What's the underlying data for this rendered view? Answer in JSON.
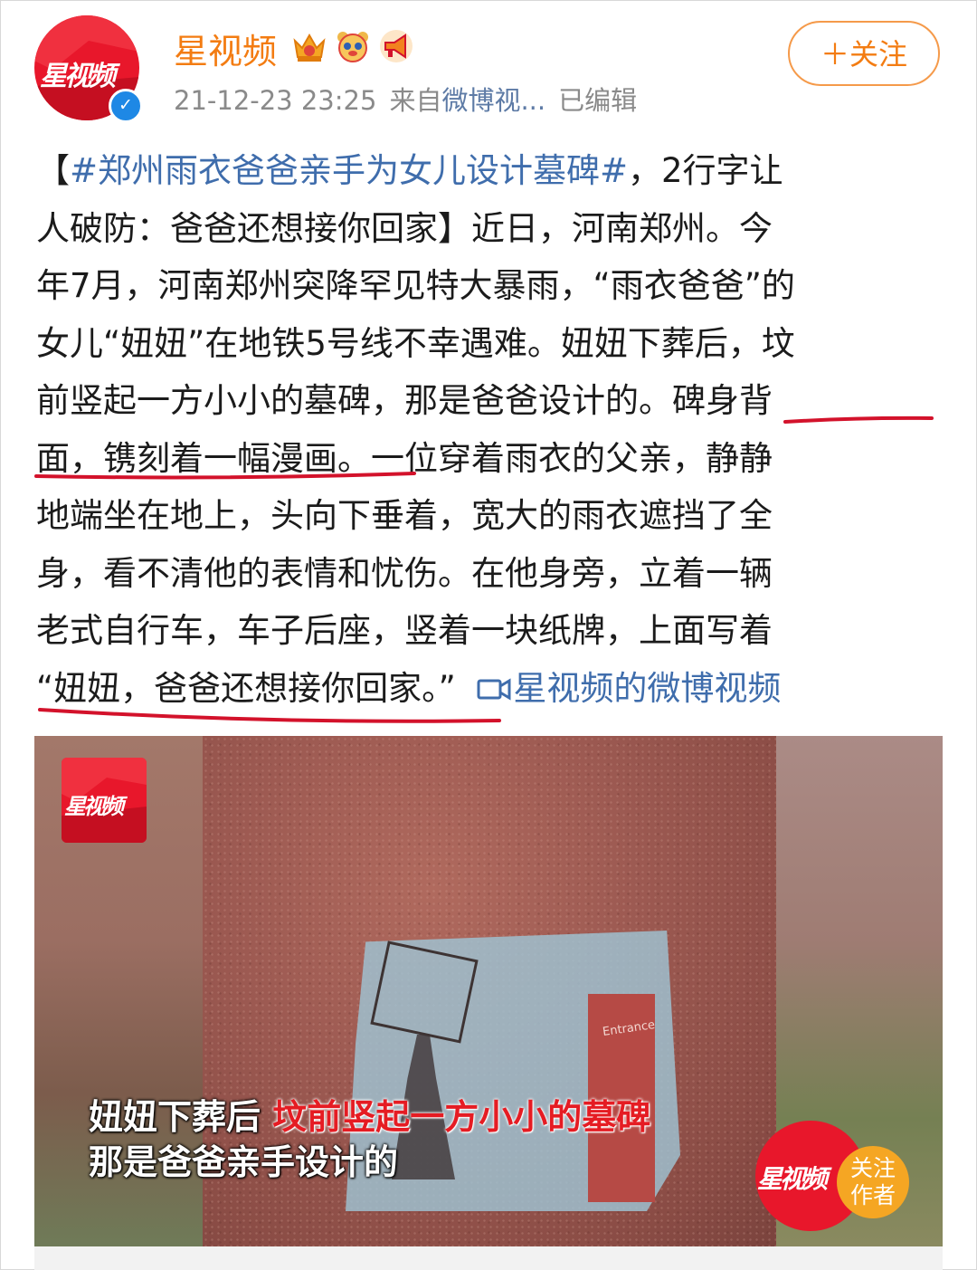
{
  "header": {
    "username": "星视频",
    "timestamp": "21-12-23 23:25",
    "source_prefix": "来自",
    "source": "微博视...",
    "edited": "已编辑",
    "follow_label": "＋关注",
    "avatar_text": "星视频",
    "badges": [
      "crown-badge-icon",
      "bear-badge-icon",
      "megaphone-badge-icon"
    ]
  },
  "post": {
    "lines": [
      [
        "【",
        "#郑州雨衣爸爸亲手为女儿设计墓碑#",
        "，2行字让"
      ],
      [
        "人破防：爸爸还想接你回家】近日，河南郑州。今"
      ],
      [
        "年7月，河南郑州突降罕见特大暴雨，“雨衣爸爸”的"
      ],
      [
        "女儿“妞妞”在地铁5号线不幸遇难。妞妞下葬后，坟"
      ],
      [
        "前竖起一方小小的墓碑，那是爸爸设计的。碑身背"
      ],
      [
        "面，镌刻着一幅漫画。一位穿着雨衣的父亲，静静"
      ],
      [
        "地端坐在地上，头向下垂着，宽大的雨衣遮挡了全"
      ],
      [
        "身，看不清他的表情和忧伤。在他身旁，立着一辆"
      ],
      [
        "老式自行车，车子后座，竖着一块纸牌，上面写着"
      ],
      [
        "“妞妞，爸爸还想接你回家。”"
      ]
    ],
    "video_link": "星视频的微博视频"
  },
  "video": {
    "logo_text": "星视频",
    "subtitle_line1_white": "妞妞下葬后",
    "subtitle_line1_red": "坟前竖起一方小小的墓碑",
    "subtitle_line2": "那是爸爸亲手设计的",
    "sign_text": "Entrance",
    "follow_author": "关注作者",
    "follow_author_l1": "关注",
    "follow_author_l2": "作者"
  },
  "colors": {
    "brand_orange": "#f37c12",
    "link_blue": "#3f6dac",
    "underline_red": "#d3122b",
    "logo_red": "#e8172b"
  }
}
